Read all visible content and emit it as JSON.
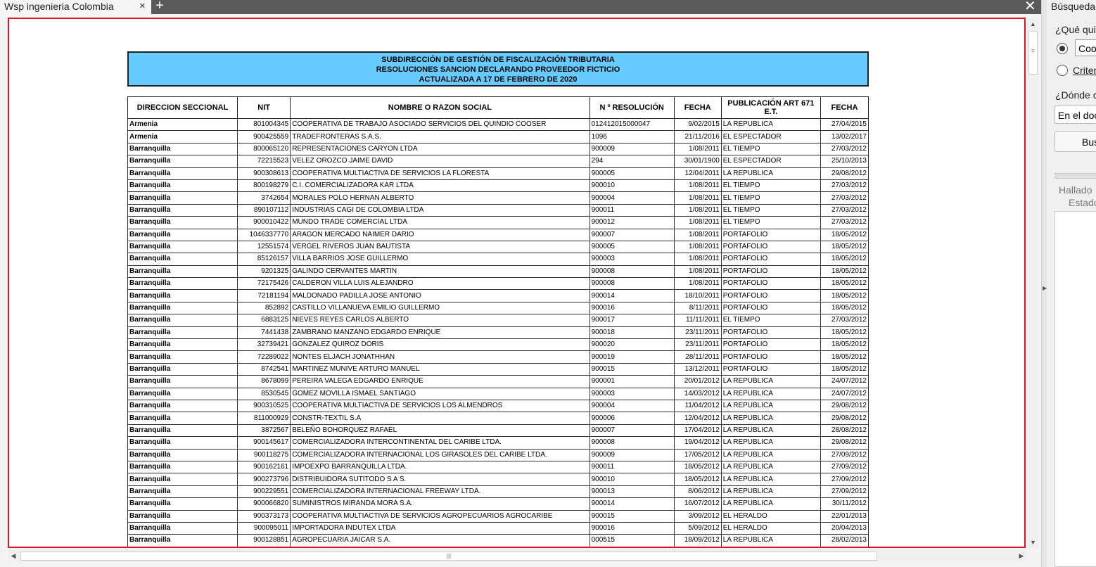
{
  "tab": {
    "title": "Wsp ingenieria Colombia",
    "close_glyph": "×",
    "add_glyph": "+"
  },
  "window": {
    "close_glyph": "✕"
  },
  "document": {
    "header_lines": [
      "SUBDIRECCIÓN DE GESTIÓN DE FISCALIZACIÓN TRIBUTARIA",
      "RESOLUCIONES SANCION DECLARANDO PROVEEDOR FICTICIO",
      "ACTUALIZADA A 17 DE FEBRERO   DE 2020"
    ],
    "columns": [
      "DIRECCION SECCIONAL",
      "NIT",
      "NOMBRE O RAZON SOCIAL",
      "N º RESOLUCIÓN",
      "FECHA",
      "PUBLICACIÓN  ART 671 E.T.",
      "FECHA"
    ],
    "rows": [
      [
        "Armenia",
        "801004345",
        "COOPERATIVA DE TRABAJO ASOCIADO SERVICIOS DEL QUINDIO COOSER",
        "012412015000047",
        "9/02/2015",
        "LA REPUBLICA",
        "27/04/2015"
      ],
      [
        "Armenia",
        "900425559",
        "TRADEFRONTERAS S.A.S.",
        "1096",
        "21/11/2016",
        "EL ESPECTADOR",
        "13/02/2017"
      ],
      [
        "Barranquilla",
        "800065120",
        "REPRESENTACIONES CARYON LTDA",
        "900009",
        "1/08/2011",
        "EL TIEMPO",
        "27/03/2012"
      ],
      [
        "Barranquilla",
        "72215523",
        "VELEZ OROZCO JAIME DAVID",
        "294",
        "30/01/1900",
        "EL ESPECTADOR",
        "25/10/2013"
      ],
      [
        "Barranquilla",
        "900308613",
        "COOPERATIVA MULTIACTIVA DE SERVICIOS LA FLORESTA",
        "900005",
        "12/04/2011",
        "LA REPUBLICA",
        "29/08/2012"
      ],
      [
        "Barranquilla",
        "800198279",
        "C.I. COMERCIALIZADORA KAR LTDA",
        "900010",
        "1/08/2011",
        "EL TIEMPO",
        "27/03/2012"
      ],
      [
        "Barranquilla",
        "3742654",
        "MORALES POLO HERNAN ALBERTO",
        "900004",
        "1/08/2011",
        "EL TIEMPO",
        "27/03/2012"
      ],
      [
        "Barranquilla",
        "890107112",
        "INDUSTRIAS CAGI DE COLOMBIA LTDA",
        "900011",
        "1/08/2011",
        "EL TIEMPO",
        "27/03/2012"
      ],
      [
        "Barranquilla",
        "900010422",
        "MUNDO TRADE COMERCIAL LTDA",
        "900012",
        "1/08/2011",
        "EL TIEMPO",
        "27/03/2012"
      ],
      [
        "Barranquilla",
        "1046337770",
        "ARAGON MERCADO NAIMER DARIO",
        "900007",
        "1/08/2011",
        "PORTAFOLIO",
        "18/05/2012"
      ],
      [
        "Barranquilla",
        "12551574",
        "VERGEL RIVEROS JUAN BAUTISTA",
        "900005",
        "1/08/2011",
        "PORTAFOLIO",
        "18/05/2012"
      ],
      [
        "Barranquilla",
        "85126157",
        "VILLA BARRIOS JOSE GUILLERMO",
        "900003",
        "1/08/2011",
        "PORTAFOLIO",
        "18/05/2012"
      ],
      [
        "Barranquilla",
        "9201325",
        "GALINDO CERVANTES MARTIN",
        "900008",
        "1/08/2011",
        "PORTAFOLIO",
        "18/05/2012"
      ],
      [
        "Barranquilla",
        "72175426",
        "CALDERON VILLA LUIS ALEJANDRO",
        "900008",
        "1/08/2011",
        "PORTAFOLIO",
        "18/05/2012"
      ],
      [
        "Barranquilla",
        "72181194",
        "MALDONADO PADILLA JOSE ANTONIO",
        "900014",
        "18/10/2011",
        "PORTAFOLIO",
        "18/05/2012"
      ],
      [
        "Barranquilla",
        "852892",
        "CASTILLO VILLANUEVA EMILIO GUILLERMO",
        "900016",
        "8/11/2011",
        "PORTAFOLIO",
        "18/05/2012"
      ],
      [
        "Barranquilla",
        "6883125",
        "NIEVES REYES CARLOS ALBERTO",
        "900017",
        "11/11/2011",
        "EL TIEMPO",
        "27/03/2012"
      ],
      [
        "Barranquilla",
        "7441438",
        "ZAMBRANO MANZANO EDGARDO ENRIQUE",
        "900018",
        "23/11/2011",
        "PORTAFOLIO",
        "18/05/2012"
      ],
      [
        "Barranquilla",
        "32739421",
        "GONZALEZ QUIROZ DORIS",
        "900020",
        "23/11/2011",
        "PORTAFOLIO",
        "18/05/2012"
      ],
      [
        "Barranquilla",
        "72289022",
        "NONTES ELJACH JONATHHAN",
        "900019",
        "28/11/2011",
        "PORTAFOLIO",
        "18/05/2012"
      ],
      [
        "Barranquilla",
        "8742541",
        "MARTINEZ MUNIVE ARTURO MANUEL",
        "900015",
        "13/12/2011",
        "PORTAFOLIO",
        "18/05/2012"
      ],
      [
        "Barranquilla",
        "8678099",
        "PEREIRA VALEGA EDGARDO ENRIQUE",
        "900001",
        "20/01/2012",
        "LA REPUBLICA",
        "24/07/2012"
      ],
      [
        "Barranquilla",
        "8530545",
        "GOMEZ MOVILLA ISMAEL SANTIAGO",
        "900003",
        "14/03/2012",
        "LA REPUBLICA",
        "24/07/2012"
      ],
      [
        "Barranquilla",
        "900310525",
        "COOPERATIVA MULTIACTIVA DE SERVICIOS LOS ALMENDROS",
        "900004",
        "11/04/2012",
        "LA REPUBLICA",
        "29/08/2012"
      ],
      [
        "Barranquilla",
        "811000929",
        "CONSTR-TEXTIL S.A",
        "900006",
        "12/04/2012",
        "LA REPUBLICA",
        "29/08/2012"
      ],
      [
        "Barranquilla",
        "3872567",
        "BELEÑO BOHORQUEZ RAFAEL",
        "900007",
        "17/04/2012",
        "LA REPUBLICA",
        "28/08/2012"
      ],
      [
        "Barranquilla",
        "900145617",
        "COMERCIALIZADORA INTERCONTINENTAL DEL CARIBE LTDA.",
        "900008",
        "19/04/2012",
        "LA REPUBLICA",
        "29/08/2012"
      ],
      [
        "Barranquilla",
        "900118275",
        "COMERCIALIZADORA INTERNACIONAL LOS GIRASOLES DEL CARIBE LTDA.",
        "900009",
        "17/05/2012",
        "LA REPUBLICA",
        "27/09/2012"
      ],
      [
        "Barranquilla",
        "900162161",
        "IMPOEXPO BARRANQUILLA LTDA.",
        "900011",
        "18/05/2012",
        "LA REPUBLICA",
        "27/09/2012"
      ],
      [
        "Barranquilla",
        "900273796",
        "DISTRIBUIDORA SUTITODO S A S.",
        "900010",
        "18/05/2012",
        "LA REPUBLICA",
        "27/09/2012"
      ],
      [
        "Barranquilla",
        "900229551",
        "COMERCIALIZADORA INTERNACIONAL FREEWAY LTDA.",
        "900013",
        "8/06/2012",
        "LA REPUBLICA",
        "27/09/2012"
      ],
      [
        "Barranquilla",
        "900066820",
        "SUMINISTROS MIRANDA MORA S.A.",
        "900014",
        "16/07/2012",
        "LA REPUBLICA",
        "30/11/2012"
      ],
      [
        "Barranquilla",
        "900373173",
        "COOPERATIVA MULTIACTIVA DE SERVICIOS AGROPECUARIOS AGROCARIBE",
        "900015",
        "3/09/2012",
        "EL HERALDO",
        "22/01/2013"
      ],
      [
        "Barranquilla",
        "900095011",
        "IMPORTADORA INDUTEX LTDA",
        "900016",
        "5/09/2012",
        "EL HERALDO",
        "20/04/2013"
      ],
      [
        "Barranquilla",
        "900128851",
        "AGROPECUARIA JAICAR S.A.",
        "000515",
        "18/09/2012",
        "LA REPUBLICA",
        "28/02/2013"
      ]
    ]
  },
  "panel": {
    "title": "Búsqueda",
    "question1": "¿Qué qui",
    "option1": "Coo",
    "option2": "Criter",
    "question2": "¿Dónde c",
    "location": "En el doc",
    "search_button": "Bus",
    "found": "Hallado",
    "state": "Estado"
  },
  "icons": {
    "scroll_up": "▲",
    "scroll_down": "▼",
    "scroll_left": "◀",
    "scroll_right": "▶",
    "splitter": "▶",
    "vgrip": "≡",
    "hgrip": "|||"
  }
}
